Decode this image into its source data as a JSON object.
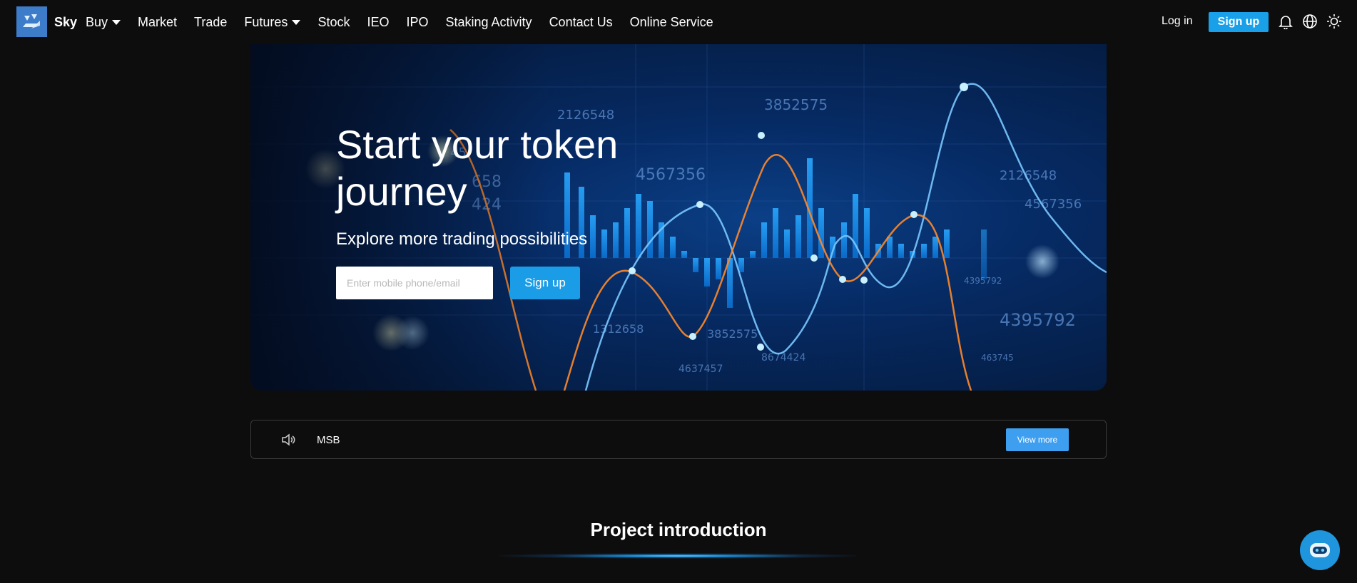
{
  "header": {
    "brand": "Sky",
    "nav": [
      {
        "label": "Buy",
        "dropdown": true
      },
      {
        "label": "Market",
        "dropdown": false
      },
      {
        "label": "Trade",
        "dropdown": false
      },
      {
        "label": "Futures",
        "dropdown": true
      },
      {
        "label": "Stock",
        "dropdown": false
      },
      {
        "label": "IEO",
        "dropdown": false
      },
      {
        "label": "IPO",
        "dropdown": false
      },
      {
        "label": "Staking Activity",
        "dropdown": false
      },
      {
        "label": "Contact Us",
        "dropdown": false
      },
      {
        "label": "Online Service",
        "dropdown": false
      }
    ],
    "login_label": "Log in",
    "signup_label": "Sign up",
    "icons": [
      "bell-icon",
      "globe-icon",
      "sun-icon"
    ]
  },
  "hero": {
    "title": "Start your token journey",
    "subtitle": "Explore more trading possibilities",
    "input_placeholder": "Enter mobile phone/email",
    "signup_label": "Sign up"
  },
  "notice": {
    "text": "MSB",
    "view_more_label": "View more"
  },
  "section": {
    "title": "Project introduction"
  },
  "colors": {
    "accent": "#1aa0e8",
    "background": "#0d0d0d"
  }
}
